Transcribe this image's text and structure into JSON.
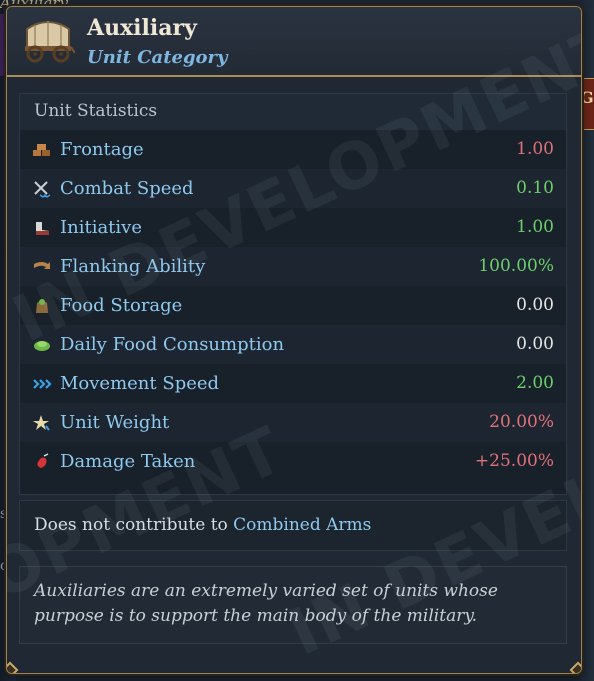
{
  "background": {
    "left_title": "Auxiliary",
    "right_button_text": "Ga",
    "edge_left_1": "s",
    "edge_left_2": "c"
  },
  "tooltip": {
    "title": "Auxiliary",
    "subtitle": "Unit Category",
    "header_icon": "wagon-icon"
  },
  "stats": {
    "heading": "Unit Statistics",
    "rows": [
      {
        "label": "Frontage",
        "value": "1.00",
        "icon": "bricks-icon",
        "color": "#e0727a"
      },
      {
        "label": "Combat Speed",
        "value": "0.10",
        "icon": "crossed-swords-icon",
        "color": "#6ccf6c"
      },
      {
        "label": "Initiative",
        "value": "1.00",
        "icon": "boot-icon",
        "color": "#6ccf6c"
      },
      {
        "label": "Flanking Ability",
        "value": "100.00%",
        "icon": "flank-arrow-icon",
        "color": "#6ccf6c"
      },
      {
        "label": "Food Storage",
        "value": "0.00",
        "icon": "food-sack-icon",
        "color": "#e6e6e6"
      },
      {
        "label": "Daily Food Consumption",
        "value": "0.00",
        "icon": "food-bowl-icon",
        "color": "#e6e6e6"
      },
      {
        "label": "Movement Speed",
        "value": "2.00",
        "icon": "chevrons-icon",
        "color": "#6ccf6c"
      },
      {
        "label": "Unit Weight",
        "value": "20.00%",
        "icon": "star-icon",
        "color": "#e0727a"
      },
      {
        "label": "Damage Taken",
        "value": "+25.00%",
        "icon": "blood-drop-icon",
        "color": "#e0727a"
      }
    ]
  },
  "combined": {
    "prefix": "Does not contribute to",
    "link": "Combined Arms"
  },
  "description": "Auxiliaries are an extremely varied set of units whose purpose is to support the main body of the military.",
  "watermark": {
    "line1": "IN DEVELOPMENT",
    "line2": "OPMENT",
    "line3": "IN DEVEL"
  }
}
